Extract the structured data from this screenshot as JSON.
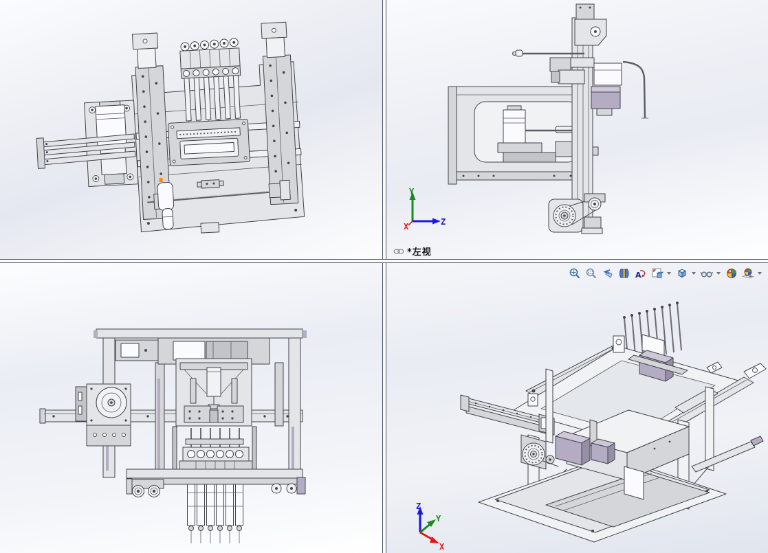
{
  "left_view_label": {
    "icon": "link-icon",
    "text": "*左视"
  },
  "triad_left_view": {
    "x": "X",
    "y": "Y",
    "z": "Z"
  },
  "triad_isometric": {
    "x": "X",
    "y": "Y",
    "z": "Z"
  },
  "heads_up_toolbar": {
    "items": [
      {
        "id": "zoom-to-fit",
        "icon": "magnifier-icon",
        "has_dropdown": false
      },
      {
        "id": "zoom-to-area",
        "icon": "magnifier-area-icon",
        "has_dropdown": false
      },
      {
        "id": "previous-view",
        "icon": "back-arrow-view-icon",
        "has_dropdown": false
      },
      {
        "id": "section-view",
        "icon": "section-cut-icon",
        "has_dropdown": false
      },
      {
        "id": "dynamic-annotation-views",
        "icon": "rotate-a-icon",
        "has_dropdown": false
      },
      {
        "id": "view-orientation",
        "icon": "view-cube-sheet-icon",
        "has_dropdown": true
      },
      {
        "id": "display-style",
        "icon": "shaded-cube-icon",
        "has_dropdown": true
      },
      {
        "id": "hide-show-items",
        "icon": "eyeglasses-icon",
        "has_dropdown": true
      },
      {
        "id": "edit-appearance",
        "icon": "color-ball-icon",
        "has_dropdown": false
      },
      {
        "id": "apply-scene",
        "icon": "scene-ball-icon",
        "has_dropdown": true
      }
    ]
  },
  "colors": {
    "axis_x": "#e01a1a",
    "axis_y": "#1c8a1c",
    "axis_z": "#1a1ae0",
    "background_gradient_top": "#fbfcfe",
    "background_gradient_mid": "#e8ebf2",
    "splitter_line": "#4a5163",
    "part_outline": "#41434a",
    "part_fill_light": "#f1f2f4",
    "part_fill": "#e4e5e8",
    "lavender_accent": "#b3acc2",
    "orange_marker": "#ff8a00",
    "toolbar_icon_blue": "#3a6ea8"
  }
}
